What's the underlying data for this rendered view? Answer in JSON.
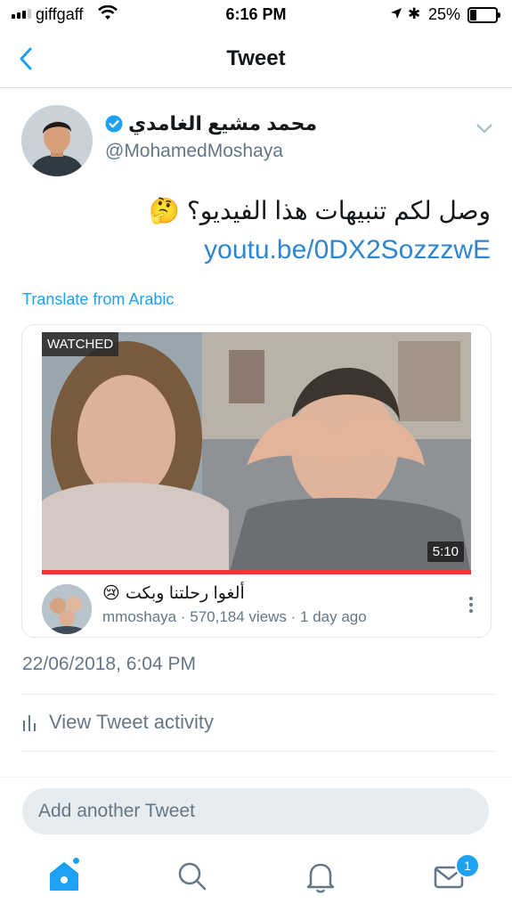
{
  "status_bar": {
    "carrier": "giffgaff",
    "time": "6:16 PM",
    "battery_percent": "25%",
    "battery_level": 0.25,
    "icons": [
      "signal-icon",
      "wifi-icon",
      "location-arrow-icon",
      "bluetooth-icon",
      "battery-icon"
    ]
  },
  "nav": {
    "title": "Tweet",
    "back_icon": "chevron-left-icon"
  },
  "tweet": {
    "display_name": "محمد مشيع الغامدي",
    "verified": true,
    "handle": "@MohamedMoshaya",
    "text": "وصل لكم تنبيهات هذا الفيديو؟",
    "emoji": "🤔",
    "link": "youtu.be/0DX2SozzzwE",
    "translate_label": "Translate from Arabic",
    "timestamp": "22/06/2018, 6:04 PM"
  },
  "video_card": {
    "watched_label": "WATCHED",
    "duration": "5:10",
    "watched_progress": 1.0,
    "title": "ألغوا رحلتنا وبكت",
    "title_emoji": "😢",
    "meta": "mmoshaya · 570,184 views · 1 day ago"
  },
  "actions": {
    "activity_label": "View Tweet activity"
  },
  "compose": {
    "placeholder": "Add another Tweet"
  },
  "tabbar": {
    "items": [
      "home-icon",
      "search-icon",
      "notifications-icon",
      "messages-icon"
    ],
    "messages_badge": "1"
  },
  "colors": {
    "accent": "#1da1f2",
    "link": "#2e86d1",
    "muted": "#657786",
    "progress": "#e53935"
  }
}
